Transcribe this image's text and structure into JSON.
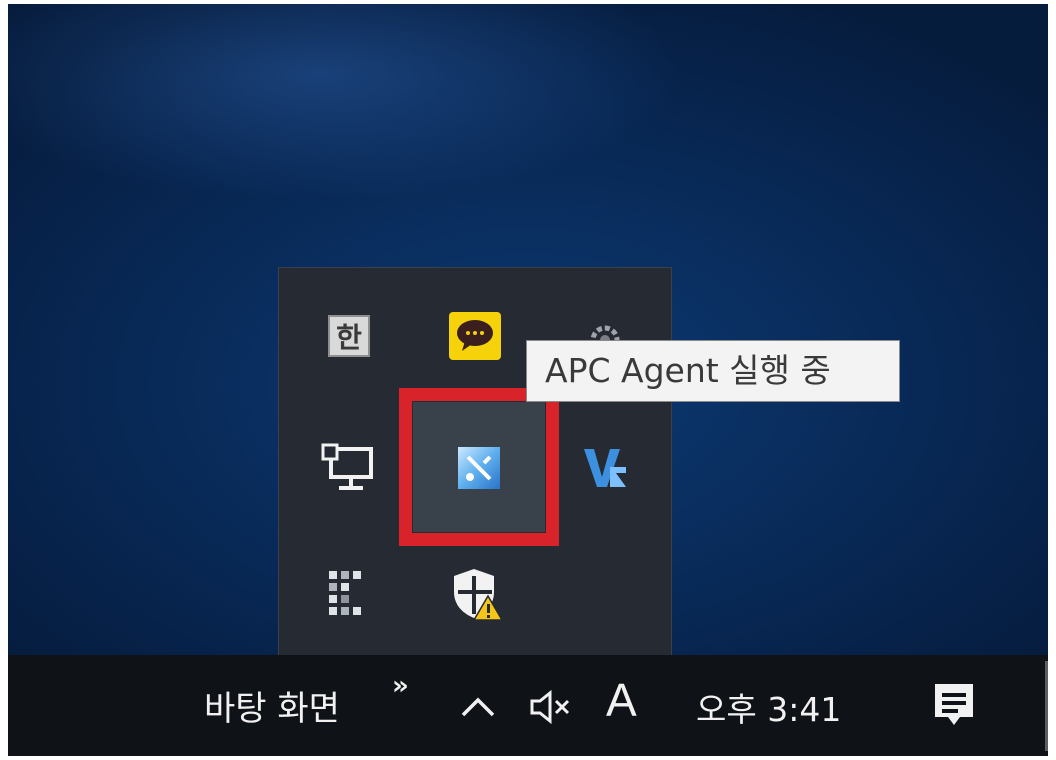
{
  "tooltip": {
    "text": "APC Agent 실행 중"
  },
  "tray": {
    "icons": [
      {
        "name": "hangul-ime-icon",
        "glyph": "한"
      },
      {
        "name": "kakaotalk-icon"
      },
      {
        "name": "gear-icon"
      },
      {
        "name": "network-icon"
      },
      {
        "name": "apc-agent-icon",
        "highlighted": true
      },
      {
        "name": "vs-icon"
      },
      {
        "name": "grid-icon"
      },
      {
        "name": "security-warning-icon"
      }
    ]
  },
  "taskbar": {
    "desktop_label": "바탕 화면",
    "toolbar_chevron": "»",
    "ime_indicator": "A",
    "clock": "오후 3:41"
  },
  "colors": {
    "highlight": "#d8232a",
    "taskbar": "#0f1216",
    "flyout": "#262b33",
    "kakao_yellow": "#f6d20a"
  }
}
